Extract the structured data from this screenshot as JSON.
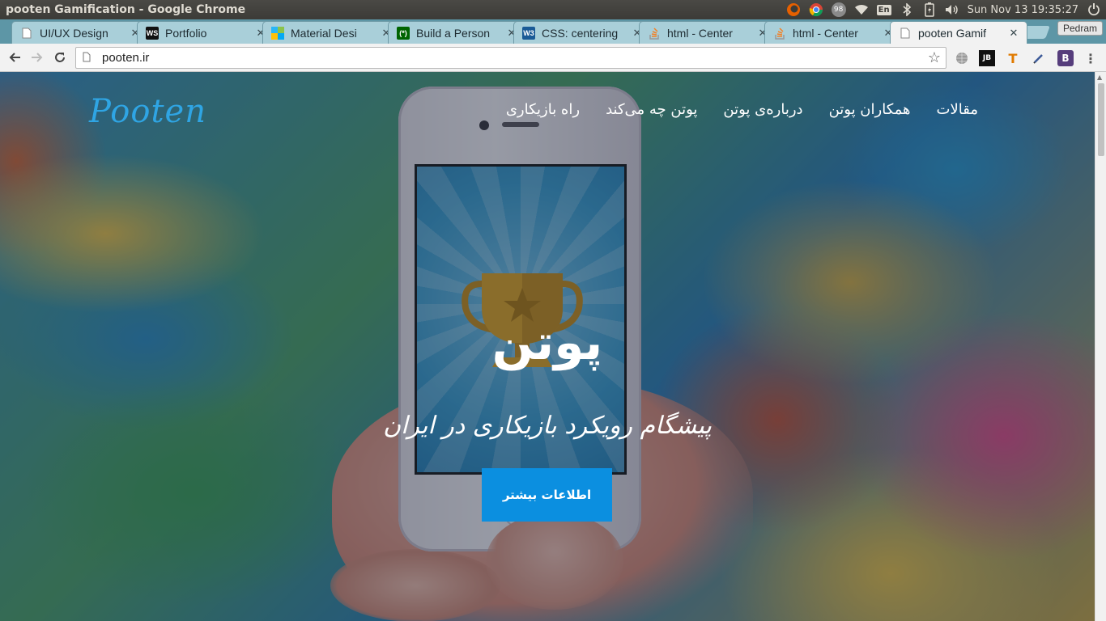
{
  "window": {
    "title": "pooten Gamification - Google Chrome"
  },
  "tray": {
    "keyboard_layout": "En",
    "badge_count": "98",
    "clock": "Sun Nov 13 19:35:27"
  },
  "tabs": [
    {
      "label": "UI/UX Design",
      "favicon": "page-icon"
    },
    {
      "label": "Portfolio",
      "favicon": "ws-icon"
    },
    {
      "label": "Material Desi",
      "favicon": "material-icon"
    },
    {
      "label": "Build a Person",
      "favicon": "fcc-icon"
    },
    {
      "label": "CSS: centering",
      "favicon": "w3c-icon"
    },
    {
      "label": "html - Center",
      "favicon": "stackoverflow-icon"
    },
    {
      "label": "html - Center",
      "favicon": "stackoverflow-icon"
    },
    {
      "label": "pooten Gamif",
      "favicon": "page-icon",
      "active": true
    }
  ],
  "profile": {
    "name": "Pedram"
  },
  "omnibox": {
    "url": "pooten.ir"
  },
  "extensions": [
    "globe-icon",
    "jb-icon",
    "hammer-icon",
    "pen-icon",
    "bootstrap-icon",
    "menu-icon"
  ],
  "site": {
    "logo": "Pooten",
    "nav": [
      "راه بازیکاری",
      "پوتن چه می‌کند",
      "درباره‌ی پوتن",
      "همکاران پوتن",
      "مقالات"
    ],
    "hero_title": "پوتن",
    "hero_subtitle": "پیشگام رویکرد بازیکاری در ایران",
    "cta_label": "اطلاعات بیشتر"
  },
  "colors": {
    "accent": "#0b8fe0",
    "logo": "#2fa5e4",
    "tab_strip": "#5d96a6",
    "titlebar": "#3c3b37"
  }
}
